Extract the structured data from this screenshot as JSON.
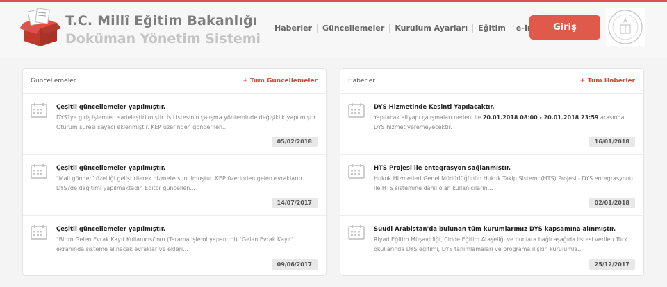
{
  "brand": {
    "line1": "T.C. Millî Eğitim Bakanlığı",
    "line2": "Doküman Yönetim Sistemi"
  },
  "nav": [
    "Haberler",
    "Güncellemeler",
    "Kurulum Ayarları",
    "Eğitim",
    "e-İmza"
  ],
  "login_label": "Giriş",
  "colors": {
    "accent": "#e05a4b",
    "link": "#d2493b"
  },
  "updates": {
    "title": "Güncellemeler",
    "all_link": "+ Tüm Güncellemeler",
    "items": [
      {
        "title": "Çeşitli güncellemeler yapılmıştır.",
        "body": "DYS?ye giriş işlemleri sadeleştirilmiştir. İş Listesinin çalışma yönteminde değişiklik yapılmıştır. Oturum süresi sayacı eklenmiştir. KEP üzerinden gönderilen...",
        "date": "05/02/2018"
      },
      {
        "title": "Çeşitli güncellemeler yapılmıştır.",
        "body": "\"Mail gönder\" özelliği geliştirilerek hizmete sunulmuştur. KEP üzerinden gelen evrakların DYS?de dağıtımı yapılmaktadır. Editör güncellen...",
        "date": "14/07/2017"
      },
      {
        "title": "Çeşitli güncellemeler yapılmıştır.",
        "body": "\"Birim Gelen Evrak Kayıt Kullanıcısı\"nın (Tarama işlemi yapan rol) \"Gelen Evrak Kayıt\" ekranında sisteme alınacak evraklar ve ekleri...",
        "date": "09/06/2017"
      }
    ]
  },
  "news": {
    "title": "Haberler",
    "all_link": "+ Tüm Haberler",
    "items": [
      {
        "title": "DYS Hizmetinde Kesinti Yapılacaktır.",
        "body_pre": "Yapılacak altyapı çalışmaları nedeni ile ",
        "body_bold": "20.01.2018 08:00 - 20.01.2018 23:59",
        "body_post": " arasında DYS hizmet veremeyecektir.",
        "date": "16/01/2018"
      },
      {
        "title": "HTS Projesi ile entegrasyon sağlanmıştır.",
        "body": "Hukuk Hizmetleri Genel Müdürlüğünün Hukuk Takip Sistemi (HTS) Projesi - DYS entegrasyonu ile HTS sistemine dâhil olan kullanıcıların...",
        "date": "02/01/2018"
      },
      {
        "title": "Suudi Arabistan'da bulunan tüm kurumlarımız DYS kapsamına alınmıştır.",
        "body": "Riyad Eğitim Müşavirliği, Cidde Eğitim Ataşeliği ve bunlara bağlı aşağıda listesi verilen Türk okullarında DYS eğitimi, DYS tanımlamaları ve programa ilişkin kurulumla...",
        "date": "25/12/2017"
      }
    ]
  }
}
